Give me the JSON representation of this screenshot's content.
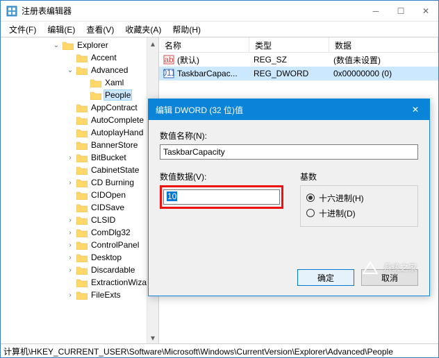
{
  "window": {
    "title": "注册表编辑器",
    "controls": {
      "min": "─",
      "max": "☐",
      "close": "✕"
    }
  },
  "menu": {
    "file": "文件(F)",
    "edit": "编辑(E)",
    "view": "查看(V)",
    "favorites": "收藏夹(A)",
    "help": "帮助(H)"
  },
  "tree": {
    "root": "Explorer",
    "items": [
      {
        "label": "Accent",
        "depth": 1
      },
      {
        "label": "Advanced",
        "depth": 1,
        "expanded": true
      },
      {
        "label": "Xaml",
        "depth": 2
      },
      {
        "label": "People",
        "depth": 2,
        "selected": true
      },
      {
        "label": "AppContract",
        "depth": 1
      },
      {
        "label": "AutoComplete",
        "depth": 1
      },
      {
        "label": "AutoplayHand",
        "depth": 1
      },
      {
        "label": "BannerStore",
        "depth": 1
      },
      {
        "label": "BitBucket",
        "depth": 1
      },
      {
        "label": "CabinetState",
        "depth": 1
      },
      {
        "label": "CD Burning",
        "depth": 1
      },
      {
        "label": "CIDOpen",
        "depth": 1
      },
      {
        "label": "CIDSave",
        "depth": 1
      },
      {
        "label": "CLSID",
        "depth": 1
      },
      {
        "label": "ComDlg32",
        "depth": 1
      },
      {
        "label": "ControlPanel",
        "depth": 1
      },
      {
        "label": "Desktop",
        "depth": 1
      },
      {
        "label": "Discardable",
        "depth": 1
      },
      {
        "label": "ExtractionWiza",
        "depth": 1
      },
      {
        "label": "FileExts",
        "depth": 1
      }
    ]
  },
  "list": {
    "headers": {
      "name": "名称",
      "type": "类型",
      "data": "数据"
    },
    "rows": [
      {
        "icon": "string",
        "name": "(默认)",
        "type": "REG_SZ",
        "data": "(数值未设置)",
        "selected": false
      },
      {
        "icon": "binary",
        "name": "TaskbarCapac...",
        "type": "REG_DWORD",
        "data": "0x00000000 (0)",
        "selected": true
      }
    ]
  },
  "statusbar": "计算机\\HKEY_CURRENT_USER\\Software\\Microsoft\\Windows\\CurrentVersion\\Explorer\\Advanced\\People",
  "dialog": {
    "title": "编辑 DWORD (32 位)值",
    "name_label": "数值名称(N):",
    "name_value": "TaskbarCapacity",
    "data_label": "数值数据(V):",
    "data_value": "10",
    "radix_label": "基数",
    "radix_hex": "十六进制(H)",
    "radix_dec": "十进制(D)",
    "ok": "确定",
    "cancel": "取消",
    "close": "✕"
  },
  "watermark": "系统之家"
}
